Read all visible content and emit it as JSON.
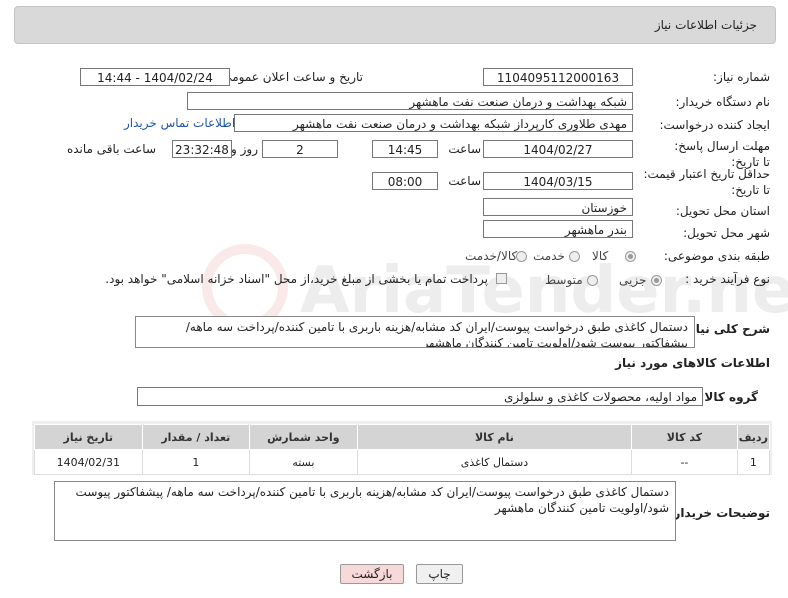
{
  "header": {
    "title": "جزئیات اطلاعات نیاز"
  },
  "fields": {
    "need_number_label": "شماره نیاز:",
    "need_number": "1104095112000163",
    "announce_label": "تاریخ و ساعت اعلان عمومی:",
    "announce_value": "1404/02/24 - 14:44",
    "buyer_org_label": "نام دستگاه خریدار:",
    "buyer_org": "شبکه بهداشت و درمان صنعت نفت ماهشهر",
    "creator_label": "ایجاد کننده درخواست:",
    "creator": "مهدی طلاوری کارپرداز شبکه بهداشت و درمان صنعت نفت ماهشهر",
    "contact_link": "اطلاعات تماس خریدار",
    "deadline_label": "مهلت ارسال پاسخ: تا تاریخ:",
    "deadline_date": "1404/02/27",
    "time_label": "ساعت",
    "deadline_time": "14:45",
    "days_value": "2",
    "days_label": "روز و",
    "remaining_time": "23:32:48",
    "remaining_label": "ساعت باقی مانده",
    "validity_label": "حداقل تاریخ اعتبار قیمت: تا تاریخ:",
    "validity_date": "1404/03/15",
    "validity_time": "08:00",
    "province_label": "استان محل تحویل:",
    "province": "خوزستان",
    "city_label": "شهر محل تحویل:",
    "city": "بندر ماهشهر",
    "category_label": "طبقه بندی موضوعی:",
    "category_options": [
      "کالا",
      "خدمت",
      "کالا/خدمت"
    ],
    "process_label": "نوع فرآیند خرید :",
    "process_options": [
      "جزیی",
      "متوسط"
    ],
    "payment_note": "پرداخت تمام یا بخشی از مبلغ خرید،از محل \"اسناد خزانه اسلامی\" خواهد بود."
  },
  "description": {
    "label": "شرح کلی نیاز:",
    "text": "دستمال کاغذی طبق درخواست پیوست/ایران کد مشابه/هزینه باربری با تامین کننده/پرداخت سه ماهه/پیشفاکتور پیوست شود/اولویت تامین کنندگان ماهشهر"
  },
  "goods": {
    "section_title": "اطلاعات کالاهای مورد نیاز",
    "group_label": "گروه کالا:",
    "group_value": "مواد اولیه، محصولات کاغذی و سلولزی"
  },
  "table": {
    "headers": [
      "ردیف",
      "کد کالا",
      "نام کالا",
      "واحد شمارش",
      "تعداد / مقدار",
      "تاریخ نیاز"
    ],
    "rows": [
      [
        "1",
        "--",
        "دستمال کاغذی",
        "بسته",
        "1",
        "1404/02/31"
      ]
    ]
  },
  "buyer_notes": {
    "label": "توضیحات خریدار:",
    "text": "دستمال کاغذی طبق درخواست پیوست/ایران کد مشابه/هزینه باربری با تامین کننده/پرداخت سه ماهه/ پیشفاکتور پیوست شود/اولویت تامین کنندگان ماهشهر"
  },
  "buttons": {
    "print": "چاپ",
    "back": "بازگشت"
  },
  "colors": {
    "header_bg": "#d9d9d9",
    "link": "#2255aa",
    "back_button_bg": "#f7d9d9",
    "table_header_bg": "#d4d4d4"
  },
  "watermark_text": "AriaTender.neT"
}
